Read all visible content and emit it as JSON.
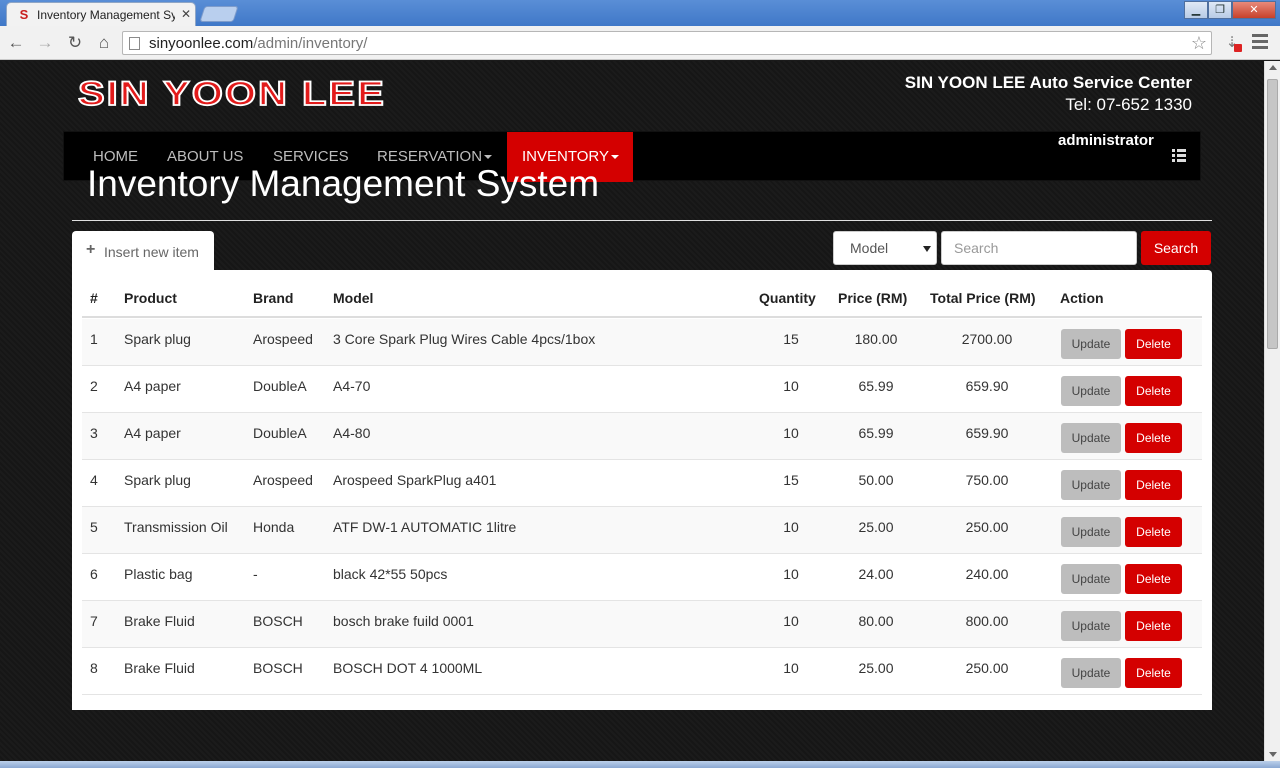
{
  "browser": {
    "tab_title": "Inventory Management System",
    "tab_favicon": "S",
    "tab_close": "✕",
    "url_host": "sinyoonlee.com",
    "url_path": "/admin/inventory/",
    "window_min": "▁",
    "window_max": "❐",
    "window_close": "✕"
  },
  "header": {
    "logo_text": "SIN YOON LEE",
    "company_name": "SIN YOON LEE Auto Service Center",
    "tel": "Tel: 07-652 1330"
  },
  "nav": {
    "items": [
      {
        "label": "HOME"
      },
      {
        "label": "ABOUT US"
      },
      {
        "label": "SERVICES"
      },
      {
        "label": "RESERVATION"
      },
      {
        "label": "INVENTORY"
      }
    ],
    "user": "administrator"
  },
  "main": {
    "title": "Inventory Management System",
    "insert_label": "Insert new item",
    "filter_value": "Model",
    "search_placeholder": "Search",
    "search_button": "Search",
    "columns": [
      "#",
      "Product",
      "Brand",
      "Model",
      "Quantity",
      "Price (RM)",
      "Total Price (RM)",
      "Action"
    ],
    "update_label": "Update",
    "delete_label": "Delete",
    "rows": [
      {
        "no": "1",
        "product": "Spark plug",
        "brand": "Arospeed",
        "model": "3 Core Spark Plug Wires Cable 4pcs/1box",
        "qty": "15",
        "price": "180.00",
        "total": "2700.00"
      },
      {
        "no": "2",
        "product": "A4 paper",
        "brand": "DoubleA",
        "model": "A4-70",
        "qty": "10",
        "price": "65.99",
        "total": "659.90"
      },
      {
        "no": "3",
        "product": "A4 paper",
        "brand": "DoubleA",
        "model": "A4-80",
        "qty": "10",
        "price": "65.99",
        "total": "659.90"
      },
      {
        "no": "4",
        "product": "Spark plug",
        "brand": "Arospeed",
        "model": "Arospeed SparkPlug a401",
        "qty": "15",
        "price": "50.00",
        "total": "750.00"
      },
      {
        "no": "5",
        "product": "Transmission Oil",
        "brand": "Honda",
        "model": "ATF DW-1 AUTOMATIC 1litre",
        "qty": "10",
        "price": "25.00",
        "total": "250.00"
      },
      {
        "no": "6",
        "product": "Plastic bag",
        "brand": "-",
        "model": "black 42*55 50pcs",
        "qty": "10",
        "price": "24.00",
        "total": "240.00"
      },
      {
        "no": "7",
        "product": "Brake Fluid",
        "brand": "BOSCH",
        "model": "bosch brake fuild 0001",
        "qty": "10",
        "price": "80.00",
        "total": "800.00"
      },
      {
        "no": "8",
        "product": "Brake Fluid",
        "brand": "BOSCH",
        "model": "BOSCH DOT 4 1000ML",
        "qty": "10",
        "price": "25.00",
        "total": "250.00"
      }
    ]
  }
}
